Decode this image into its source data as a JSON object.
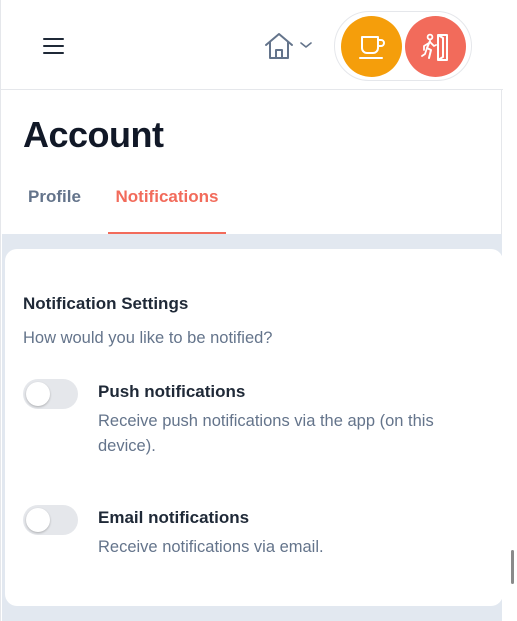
{
  "header": {
    "menu_icon": "hamburger-menu-icon",
    "home_icon": "home-icon",
    "dropdown_icon": "chevron-down-icon",
    "break_icon": "coffee-cup-icon",
    "exit_icon": "exit-door-icon",
    "colors": {
      "break_button": "#f59e0b",
      "exit_button": "#f26b5b"
    }
  },
  "page": {
    "title": "Account"
  },
  "tabs": [
    {
      "label": "Profile",
      "active": false
    },
    {
      "label": "Notifications",
      "active": true
    }
  ],
  "notification_settings": {
    "title": "Notification Settings",
    "subtitle": "How would you like to be notified?",
    "options": [
      {
        "label": "Push notifications",
        "description": "Receive push notifications via the app (on this device).",
        "enabled": false
      },
      {
        "label": "Email notifications",
        "description": "Receive notifications via email.",
        "enabled": false
      }
    ]
  },
  "colors": {
    "accent": "#f26b5b",
    "muted_text": "#64748b",
    "background": "#e2e8f0"
  }
}
